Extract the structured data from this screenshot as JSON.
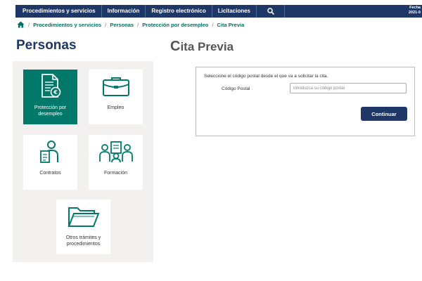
{
  "nav": {
    "items": [
      {
        "label": "Procedimientos y servicios"
      },
      {
        "label": "Información"
      },
      {
        "label": "Registro electrónico"
      },
      {
        "label": "Licitaciones"
      }
    ],
    "search_icon": "search-icon",
    "date_label": "Fecha",
    "date_value": "2021-9"
  },
  "breadcrumb": {
    "home_icon": "home-icon",
    "items": [
      "Procedimientos y servicios",
      "Personas",
      "Protección por desempleo",
      "Cita Previa"
    ]
  },
  "page": {
    "title": "Personas"
  },
  "section": {
    "title_first": "C",
    "title_rest": "ita Previa"
  },
  "tiles": [
    {
      "label": "Protección por desempleo",
      "icon": "document-euro-icon",
      "active": true
    },
    {
      "label": "Empleo",
      "icon": "briefcase-icon",
      "active": false
    },
    {
      "label": "Contratos",
      "icon": "person-document-icon",
      "active": false
    },
    {
      "label": "Formación",
      "icon": "classroom-icon",
      "active": false
    },
    {
      "label": "Otros trámites y procedimientos",
      "icon": "folder-icon",
      "active": false
    }
  ],
  "form": {
    "intro": "Seleccione el código postal desde el que va a solicitar la cita.",
    "postal_label": "Código Postal",
    "postal_value": "",
    "postal_placeholder": "Introduzca su código postal",
    "continue_label": "Continuar"
  },
  "colors": {
    "nav_bg": "#1e3766",
    "accent_green": "#00796b",
    "panel_bg": "#f3f0f0"
  }
}
